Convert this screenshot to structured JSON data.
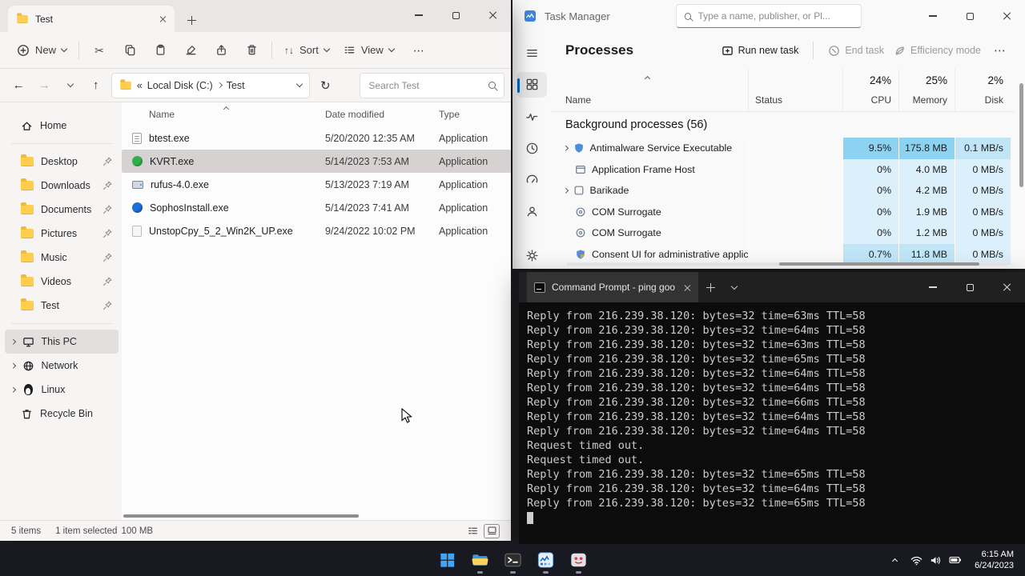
{
  "colors": {
    "accent": "#0067c0",
    "heat_low": "#dcf0fb",
    "heat_mid": "#bfe5f7",
    "heat_high": "#8ed2f2",
    "selection_gray": "#d6d2d2",
    "taskbar_bg": "#191922",
    "terminal_bg": "#0c0c0c"
  },
  "icons": {
    "back": "←",
    "forward": "→",
    "up": "↑",
    "refresh": "↻",
    "cut": "✂",
    "sort_arrows": "↑↓",
    "more": "⋯"
  },
  "explorer": {
    "tab_title": "Test",
    "toolbar": {
      "new_label": "New",
      "sort_label": "Sort",
      "view_label": "View"
    },
    "address": {
      "crumb_prefix": "«",
      "crumb1": "Local Disk (C:)",
      "crumb2": "Test",
      "search_placeholder": "Search Test"
    },
    "sidebar": {
      "home": "Home",
      "pinned": [
        {
          "label": "Desktop"
        },
        {
          "label": "Downloads"
        },
        {
          "label": "Documents"
        },
        {
          "label": "Pictures"
        },
        {
          "label": "Music"
        },
        {
          "label": "Videos"
        },
        {
          "label": "Test"
        }
      ],
      "tree": [
        {
          "label": "This PC"
        },
        {
          "label": "Network"
        },
        {
          "label": "Linux"
        },
        {
          "label": "Recycle Bin"
        }
      ]
    },
    "columns": {
      "name": "Name",
      "modified": "Date modified",
      "type": "Type"
    },
    "rows": [
      {
        "name": "btest.exe",
        "modified": "5/20/2020 12:35 AM",
        "type": "Application"
      },
      {
        "name": "KVRT.exe",
        "modified": "5/14/2023 7:53 AM",
        "type": "Application"
      },
      {
        "name": "rufus-4.0.exe",
        "modified": "5/13/2023 7:19 AM",
        "type": "Application"
      },
      {
        "name": "SophosInstall.exe",
        "modified": "5/14/2023 7:41 AM",
        "type": "Application"
      },
      {
        "name": "UnstopCpy_5_2_Win2K_UP.exe",
        "modified": "9/24/2022 10:02 PM",
        "type": "Application"
      }
    ],
    "status": {
      "count": "5 items",
      "selection": "1 item selected",
      "size": "100 MB"
    }
  },
  "taskmanager": {
    "title": "Task Manager",
    "search_placeholder": "Type a name, publisher, or Pl...",
    "page_title": "Processes",
    "actions": {
      "run": "Run new task",
      "end": "End task",
      "efficiency": "Efficiency mode"
    },
    "columns": {
      "name": "Name",
      "status": "Status",
      "cpu_total": "24%",
      "cpu": "CPU",
      "memory_total": "25%",
      "memory": "Memory",
      "disk_total": "2%",
      "disk": "Disk"
    },
    "group_label": "Background processes (56)",
    "rows": [
      {
        "name": "Antimalware Service Executable",
        "cpu": "9.5%",
        "memory": "175.8 MB",
        "disk": "0.1 MB/s"
      },
      {
        "name": "Application Frame Host",
        "cpu": "0%",
        "memory": "4.0 MB",
        "disk": "0 MB/s"
      },
      {
        "name": "Barikade",
        "cpu": "0%",
        "memory": "4.2 MB",
        "disk": "0 MB/s"
      },
      {
        "name": "COM Surrogate",
        "cpu": "0%",
        "memory": "1.9 MB",
        "disk": "0 MB/s"
      },
      {
        "name": "COM Surrogate",
        "cpu": "0%",
        "memory": "1.2 MB",
        "disk": "0 MB/s"
      },
      {
        "name": "Consent UI for administrative applicat...",
        "cpu": "0.7%",
        "memory": "11.8 MB",
        "disk": "0 MB/s"
      }
    ]
  },
  "terminal": {
    "tab_title": "Command Prompt - ping goo",
    "lines": [
      "Reply from 216.239.38.120: bytes=32 time=63ms TTL=58",
      "Reply from 216.239.38.120: bytes=32 time=64ms TTL=58",
      "Reply from 216.239.38.120: bytes=32 time=63ms TTL=58",
      "Reply from 216.239.38.120: bytes=32 time=65ms TTL=58",
      "Reply from 216.239.38.120: bytes=32 time=64ms TTL=58",
      "Reply from 216.239.38.120: bytes=32 time=64ms TTL=58",
      "Reply from 216.239.38.120: bytes=32 time=66ms TTL=58",
      "Reply from 216.239.38.120: bytes=32 time=64ms TTL=58",
      "Reply from 216.239.38.120: bytes=32 time=64ms TTL=58",
      "Request timed out.",
      "Request timed out.",
      "Reply from 216.239.38.120: bytes=32 time=65ms TTL=58",
      "Reply from 216.239.38.120: bytes=32 time=64ms TTL=58",
      "Reply from 216.239.38.120: bytes=32 time=65ms TTL=58"
    ]
  },
  "taskbar": {
    "clock_time": "6:15 AM",
    "clock_date": "6/24/2023"
  }
}
